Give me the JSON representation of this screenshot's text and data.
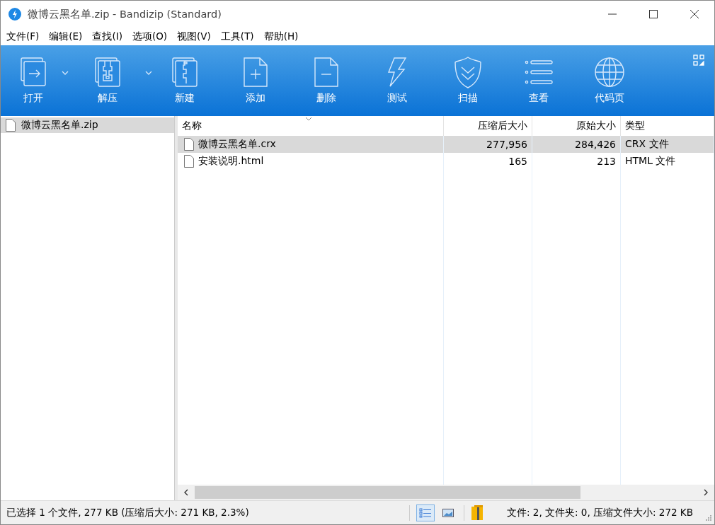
{
  "window": {
    "title": "微博云黑名单.zip - Bandizip (Standard)"
  },
  "menu": [
    "文件(F)",
    "编辑(E)",
    "查找(I)",
    "选项(O)",
    "视图(V)",
    "工具(T)",
    "帮助(H)"
  ],
  "toolbar": [
    {
      "kind": "open",
      "label": "打开",
      "dropdown": true
    },
    {
      "kind": "extract",
      "label": "解压",
      "dropdown": true
    },
    {
      "kind": "new",
      "label": "新建",
      "dropdown": false
    },
    {
      "kind": "add",
      "label": "添加",
      "dropdown": false
    },
    {
      "kind": "delete",
      "label": "删除",
      "dropdown": false
    },
    {
      "kind": "test",
      "label": "测试",
      "dropdown": false
    },
    {
      "kind": "scan",
      "label": "扫描",
      "dropdown": false
    },
    {
      "kind": "view",
      "label": "查看",
      "dropdown": false
    },
    {
      "kind": "codepage",
      "label": "代码页",
      "dropdown": false
    }
  ],
  "tree": {
    "items": [
      {
        "label": "微博云黑名单.zip",
        "selected": true
      }
    ]
  },
  "table": {
    "columns": [
      {
        "label": "名称",
        "sorted": true
      },
      {
        "label": "压缩后大小",
        "sorted": false
      },
      {
        "label": "原始大小",
        "sorted": false
      },
      {
        "label": "类型",
        "sorted": false
      }
    ],
    "rows": [
      {
        "name": "微博云黑名单.crx",
        "compressed": "277,956",
        "original": "284,426",
        "type": "CRX 文件",
        "selected": true
      },
      {
        "name": "安装说明.html",
        "compressed": "165",
        "original": "213",
        "type": "HTML 文件",
        "selected": false
      }
    ]
  },
  "status_bar": {
    "selection": "已选择 1 个文件, 277 KB (压缩后大小: 271 KB, 2.3%)",
    "views": [
      {
        "kind": "details",
        "selected": true
      },
      {
        "kind": "thumbnails",
        "selected": false
      }
    ],
    "summary": "文件: 2, 文件夹: 0, 压缩文件大小: 272 KB"
  }
}
